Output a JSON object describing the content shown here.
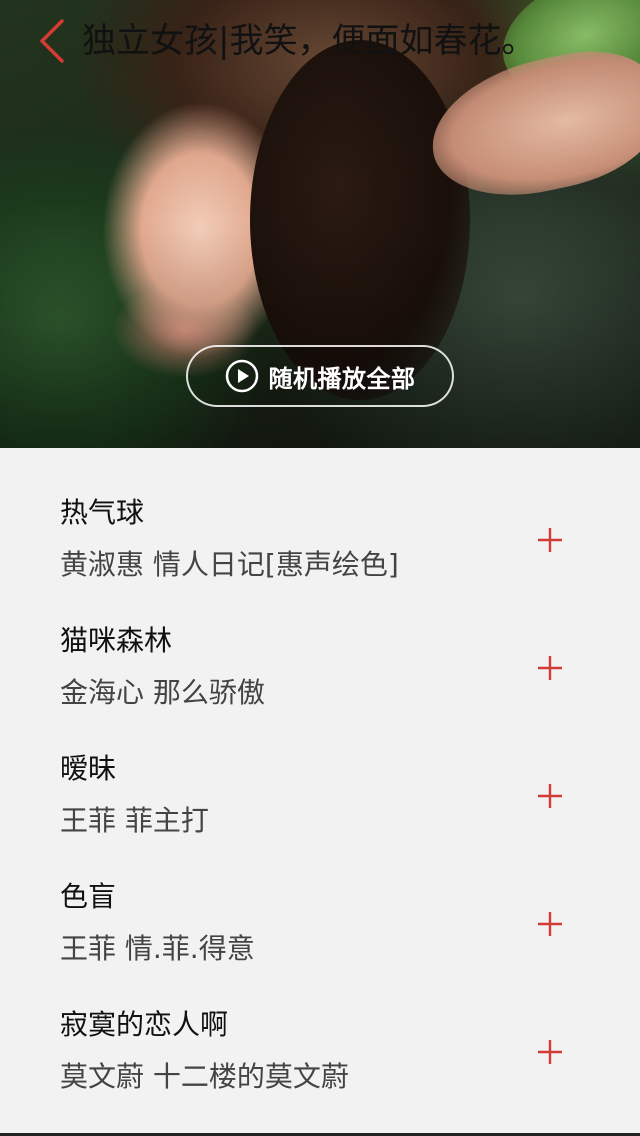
{
  "header": {
    "title": "独立女孩|我笑，便面如春花。"
  },
  "hero": {
    "shuffle_label": "随机播放全部"
  },
  "colors": {
    "accent": "#d43c33",
    "background": "#f2f2f2",
    "title_text": "#111111",
    "subtitle_text": "#444444"
  },
  "songs": [
    {
      "title": "热气球",
      "subtitle": "黄淑惠 情人日记[惠声绘色]"
    },
    {
      "title": "猫咪森林",
      "subtitle": "金海心 那么骄傲"
    },
    {
      "title": "暧昧",
      "subtitle": "王菲 菲主打"
    },
    {
      "title": "色盲",
      "subtitle": "王菲 情.菲.得意"
    },
    {
      "title": "寂寞的恋人啊",
      "subtitle": "莫文蔚 十二楼的莫文蔚"
    }
  ],
  "icons": {
    "back": "chevron-left-icon",
    "play": "play-circle-icon",
    "add": "plus-icon"
  }
}
